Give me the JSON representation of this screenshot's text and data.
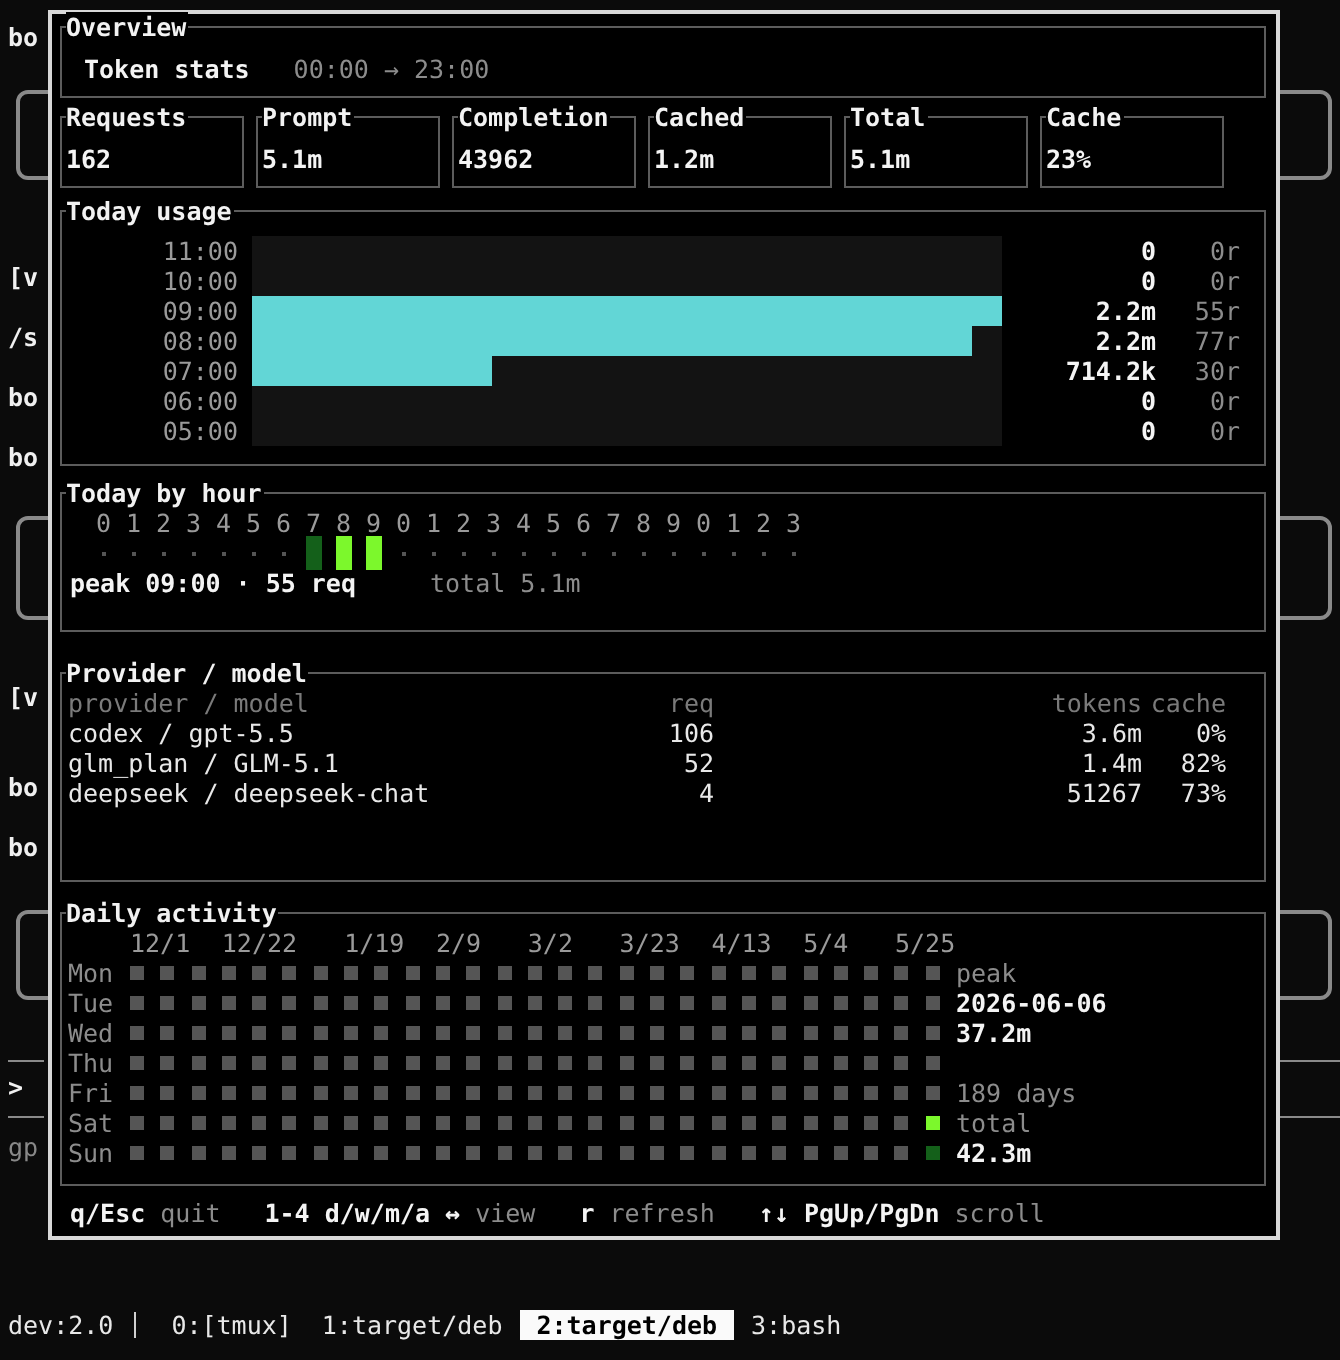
{
  "background": {
    "left_text": [
      {
        "text": "bo",
        "dim": false
      },
      {
        "text": "[v",
        "dim": false
      },
      {
        "text": "/s",
        "dim": false
      },
      {
        "text": "bo",
        "dim": false
      },
      {
        "text": "bo",
        "dim": false
      },
      {
        "text": "[v",
        "dim": false
      },
      {
        "text": "bo",
        "dim": false
      },
      {
        "text": "bo",
        "dim": false
      },
      {
        "text": ">",
        "dim": false
      },
      {
        "text": "gp",
        "dim": true
      }
    ]
  },
  "overview": {
    "title": "Overview",
    "heading": "Token stats",
    "range": "00:00 → 23:00"
  },
  "stats": [
    {
      "label": "Requests",
      "value": "162"
    },
    {
      "label": "Prompt",
      "value": "5.1m"
    },
    {
      "label": "Completion",
      "value": "43962"
    },
    {
      "label": "Cached",
      "value": "1.2m"
    },
    {
      "label": "Total",
      "value": "5.1m"
    },
    {
      "label": "Cache",
      "value": "23%"
    }
  ],
  "usage": {
    "title": "Today usage",
    "rows": [
      {
        "hour": "11:00",
        "tokens": "0",
        "requests": "0r",
        "level": 0
      },
      {
        "hour": "10:00",
        "tokens": "0",
        "requests": "0r",
        "level": 0
      },
      {
        "hour": "09:00",
        "tokens": "2.2m",
        "requests": "55r",
        "level": 1
      },
      {
        "hour": "08:00",
        "tokens": "2.2m",
        "requests": "77r",
        "level": 0.96
      },
      {
        "hour": "07:00",
        "tokens": "714.2k",
        "requests": "30r",
        "level": 0.32
      },
      {
        "hour": "06:00",
        "tokens": "0",
        "requests": "0r",
        "level": 0
      },
      {
        "hour": "05:00",
        "tokens": "0",
        "requests": "0r",
        "level": 0
      }
    ]
  },
  "by_hour": {
    "title": "Today by hour",
    "hours": [
      {
        "label": "0",
        "active": false,
        "color": "#555555"
      },
      {
        "label": "1",
        "active": false,
        "color": "#555555"
      },
      {
        "label": "2",
        "active": false,
        "color": "#555555"
      },
      {
        "label": "3",
        "active": false,
        "color": "#555555"
      },
      {
        "label": "4",
        "active": false,
        "color": "#555555"
      },
      {
        "label": "5",
        "active": false,
        "color": "#555555"
      },
      {
        "label": "6",
        "active": false,
        "color": "#555555"
      },
      {
        "label": "7",
        "active": true,
        "color": "#14601a"
      },
      {
        "label": "8",
        "active": true,
        "color": "#7cf82c"
      },
      {
        "label": "9",
        "active": true,
        "color": "#7cf82c"
      },
      {
        "label": "0",
        "active": false,
        "color": "#555555"
      },
      {
        "label": "1",
        "active": false,
        "color": "#555555"
      },
      {
        "label": "2",
        "active": false,
        "color": "#555555"
      },
      {
        "label": "3",
        "active": false,
        "color": "#555555"
      },
      {
        "label": "4",
        "active": false,
        "color": "#555555"
      },
      {
        "label": "5",
        "active": false,
        "color": "#555555"
      },
      {
        "label": "6",
        "active": false,
        "color": "#555555"
      },
      {
        "label": "7",
        "active": false,
        "color": "#555555"
      },
      {
        "label": "8",
        "active": false,
        "color": "#555555"
      },
      {
        "label": "9",
        "active": false,
        "color": "#555555"
      },
      {
        "label": "0",
        "active": false,
        "color": "#555555"
      },
      {
        "label": "1",
        "active": false,
        "color": "#555555"
      },
      {
        "label": "2",
        "active": false,
        "color": "#555555"
      },
      {
        "label": "3",
        "active": false,
        "color": "#555555"
      }
    ],
    "peak": "peak 09:00 · 55 req",
    "total": "total 5.1m"
  },
  "providers": {
    "title": "Provider / model",
    "columns": [
      "provider / model",
      "req",
      "tokens",
      "cache"
    ],
    "rows": [
      {
        "name": "codex / gpt-5.5",
        "req": "106",
        "tokens": "3.6m",
        "cache": "0%"
      },
      {
        "name": "glm_plan / GLM-5.1",
        "req": "52",
        "tokens": "1.4m",
        "cache": "82%"
      },
      {
        "name": "deepseek / deepseek-chat",
        "req": "4",
        "tokens": "51267",
        "cache": "73%"
      }
    ]
  },
  "daily": {
    "title": "Daily activity",
    "dates": [
      "12/1",
      "12/22",
      "1/19",
      "2/9",
      "3/2",
      "3/23",
      "4/13",
      "5/4",
      "5/25"
    ],
    "days": [
      {
        "label": "Mon",
        "cells": [
          {
            "color": "#555555"
          },
          {
            "color": "#555555"
          },
          {
            "color": "#555555"
          },
          {
            "color": "#555555"
          },
          {
            "color": "#555555"
          },
          {
            "color": "#555555"
          },
          {
            "color": "#555555"
          },
          {
            "color": "#555555"
          },
          {
            "color": "#555555"
          },
          {
            "color": "#555555"
          },
          {
            "color": "#555555"
          },
          {
            "color": "#555555"
          },
          {
            "color": "#555555"
          },
          {
            "color": "#555555"
          },
          {
            "color": "#555555"
          },
          {
            "color": "#555555"
          },
          {
            "color": "#555555"
          },
          {
            "color": "#555555"
          },
          {
            "color": "#555555"
          },
          {
            "color": "#555555"
          },
          {
            "color": "#555555"
          },
          {
            "color": "#555555"
          },
          {
            "color": "#555555"
          },
          {
            "color": "#555555"
          },
          {
            "color": "#555555"
          },
          {
            "color": "#555555"
          },
          {
            "color": "#555555"
          }
        ]
      },
      {
        "label": "Tue",
        "cells": [
          {
            "color": "#555555"
          },
          {
            "color": "#555555"
          },
          {
            "color": "#555555"
          },
          {
            "color": "#555555"
          },
          {
            "color": "#555555"
          },
          {
            "color": "#555555"
          },
          {
            "color": "#555555"
          },
          {
            "color": "#555555"
          },
          {
            "color": "#555555"
          },
          {
            "color": "#555555"
          },
          {
            "color": "#555555"
          },
          {
            "color": "#555555"
          },
          {
            "color": "#555555"
          },
          {
            "color": "#555555"
          },
          {
            "color": "#555555"
          },
          {
            "color": "#555555"
          },
          {
            "color": "#555555"
          },
          {
            "color": "#555555"
          },
          {
            "color": "#555555"
          },
          {
            "color": "#555555"
          },
          {
            "color": "#555555"
          },
          {
            "color": "#555555"
          },
          {
            "color": "#555555"
          },
          {
            "color": "#555555"
          },
          {
            "color": "#555555"
          },
          {
            "color": "#555555"
          },
          {
            "color": "#555555"
          }
        ]
      },
      {
        "label": "Wed",
        "cells": [
          {
            "color": "#555555"
          },
          {
            "color": "#555555"
          },
          {
            "color": "#555555"
          },
          {
            "color": "#555555"
          },
          {
            "color": "#555555"
          },
          {
            "color": "#555555"
          },
          {
            "color": "#555555"
          },
          {
            "color": "#555555"
          },
          {
            "color": "#555555"
          },
          {
            "color": "#555555"
          },
          {
            "color": "#555555"
          },
          {
            "color": "#555555"
          },
          {
            "color": "#555555"
          },
          {
            "color": "#555555"
          },
          {
            "color": "#555555"
          },
          {
            "color": "#555555"
          },
          {
            "color": "#555555"
          },
          {
            "color": "#555555"
          },
          {
            "color": "#555555"
          },
          {
            "color": "#555555"
          },
          {
            "color": "#555555"
          },
          {
            "color": "#555555"
          },
          {
            "color": "#555555"
          },
          {
            "color": "#555555"
          },
          {
            "color": "#555555"
          },
          {
            "color": "#555555"
          },
          {
            "color": "#555555"
          }
        ]
      },
      {
        "label": "Thu",
        "cells": [
          {
            "color": "#555555"
          },
          {
            "color": "#555555"
          },
          {
            "color": "#555555"
          },
          {
            "color": "#555555"
          },
          {
            "color": "#555555"
          },
          {
            "color": "#555555"
          },
          {
            "color": "#555555"
          },
          {
            "color": "#555555"
          },
          {
            "color": "#555555"
          },
          {
            "color": "#555555"
          },
          {
            "color": "#555555"
          },
          {
            "color": "#555555"
          },
          {
            "color": "#555555"
          },
          {
            "color": "#555555"
          },
          {
            "color": "#555555"
          },
          {
            "color": "#555555"
          },
          {
            "color": "#555555"
          },
          {
            "color": "#555555"
          },
          {
            "color": "#555555"
          },
          {
            "color": "#555555"
          },
          {
            "color": "#555555"
          },
          {
            "color": "#555555"
          },
          {
            "color": "#555555"
          },
          {
            "color": "#555555"
          },
          {
            "color": "#555555"
          },
          {
            "color": "#555555"
          },
          {
            "color": "#555555"
          }
        ]
      },
      {
        "label": "Fri",
        "cells": [
          {
            "color": "#555555"
          },
          {
            "color": "#555555"
          },
          {
            "color": "#555555"
          },
          {
            "color": "#555555"
          },
          {
            "color": "#555555"
          },
          {
            "color": "#555555"
          },
          {
            "color": "#555555"
          },
          {
            "color": "#555555"
          },
          {
            "color": "#555555"
          },
          {
            "color": "#555555"
          },
          {
            "color": "#555555"
          },
          {
            "color": "#555555"
          },
          {
            "color": "#555555"
          },
          {
            "color": "#555555"
          },
          {
            "color": "#555555"
          },
          {
            "color": "#555555"
          },
          {
            "color": "#555555"
          },
          {
            "color": "#555555"
          },
          {
            "color": "#555555"
          },
          {
            "color": "#555555"
          },
          {
            "color": "#555555"
          },
          {
            "color": "#555555"
          },
          {
            "color": "#555555"
          },
          {
            "color": "#555555"
          },
          {
            "color": "#555555"
          },
          {
            "color": "#555555"
          },
          {
            "color": "#555555"
          }
        ]
      },
      {
        "label": "Sat",
        "cells": [
          {
            "color": "#555555"
          },
          {
            "color": "#555555"
          },
          {
            "color": "#555555"
          },
          {
            "color": "#555555"
          },
          {
            "color": "#555555"
          },
          {
            "color": "#555555"
          },
          {
            "color": "#555555"
          },
          {
            "color": "#555555"
          },
          {
            "color": "#555555"
          },
          {
            "color": "#555555"
          },
          {
            "color": "#555555"
          },
          {
            "color": "#555555"
          },
          {
            "color": "#555555"
          },
          {
            "color": "#555555"
          },
          {
            "color": "#555555"
          },
          {
            "color": "#555555"
          },
          {
            "color": "#555555"
          },
          {
            "color": "#555555"
          },
          {
            "color": "#555555"
          },
          {
            "color": "#555555"
          },
          {
            "color": "#555555"
          },
          {
            "color": "#555555"
          },
          {
            "color": "#555555"
          },
          {
            "color": "#555555"
          },
          {
            "color": "#555555"
          },
          {
            "color": "#555555"
          },
          {
            "color": "#7cf82c"
          }
        ]
      },
      {
        "label": "Sun",
        "cells": [
          {
            "color": "#555555"
          },
          {
            "color": "#555555"
          },
          {
            "color": "#555555"
          },
          {
            "color": "#555555"
          },
          {
            "color": "#555555"
          },
          {
            "color": "#555555"
          },
          {
            "color": "#555555"
          },
          {
            "color": "#555555"
          },
          {
            "color": "#555555"
          },
          {
            "color": "#555555"
          },
          {
            "color": "#555555"
          },
          {
            "color": "#555555"
          },
          {
            "color": "#555555"
          },
          {
            "color": "#555555"
          },
          {
            "color": "#555555"
          },
          {
            "color": "#555555"
          },
          {
            "color": "#555555"
          },
          {
            "color": "#555555"
          },
          {
            "color": "#555555"
          },
          {
            "color": "#555555"
          },
          {
            "color": "#555555"
          },
          {
            "color": "#555555"
          },
          {
            "color": "#555555"
          },
          {
            "color": "#555555"
          },
          {
            "color": "#555555"
          },
          {
            "color": "#555555"
          },
          {
            "color": "#14601a"
          }
        ]
      }
    ],
    "side": [
      {
        "text": "peak",
        "dim": true
      },
      {
        "text": "2026-06-06",
        "dim": false
      },
      {
        "text": "37.2m",
        "dim": false
      },
      {
        "text": "189 days",
        "dim": true
      },
      {
        "text": "total",
        "dim": true
      },
      {
        "text": "42.3m",
        "dim": false
      }
    ]
  },
  "footer": [
    {
      "key": "q/Esc",
      "action": "quit"
    },
    {
      "key": "1-4 d/w/m/a ↔",
      "action": "view"
    },
    {
      "key": "r",
      "action": "refresh"
    },
    {
      "key": "↑↓ PgUp/PgDn",
      "action": "scroll"
    }
  ],
  "status_bar": {
    "session": "dev:2.0",
    "windows": [
      {
        "label": "0:[tmux]",
        "selected": false
      },
      {
        "label": "1:target/deb",
        "selected": false
      },
      {
        "label": "2:target/deb",
        "selected": true
      },
      {
        "label": "3:bash",
        "selected": false
      }
    ]
  }
}
